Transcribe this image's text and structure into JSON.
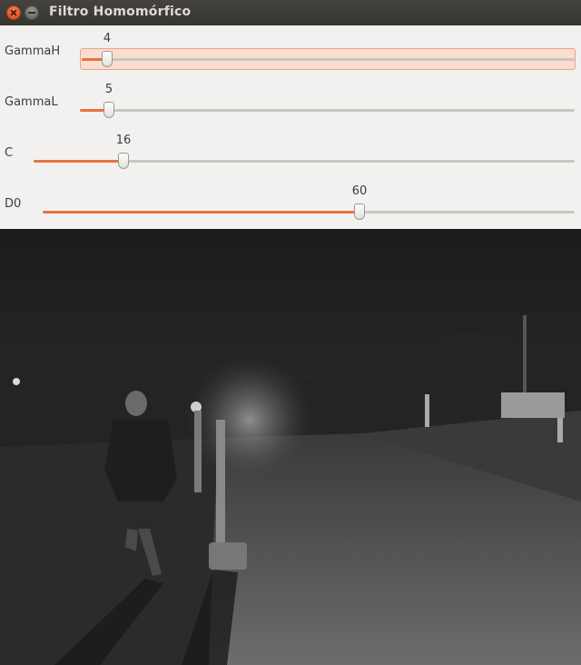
{
  "window": {
    "title": "Filtro Homomórfico"
  },
  "sliders": [
    {
      "label": "GammaH",
      "value": "4",
      "max": 100
    },
    {
      "label": "GammaL",
      "value": "5",
      "max": 100
    },
    {
      "label": "C",
      "value": "16",
      "max": 100
    },
    {
      "label": "D0",
      "value": "60",
      "max": 100
    }
  ],
  "colors": {
    "accent": "#e8733f",
    "titlebar": "#3d3b37",
    "panel": "#f2f1f0"
  },
  "icons": {
    "close": "close-icon",
    "minimize": "minimize-icon"
  }
}
